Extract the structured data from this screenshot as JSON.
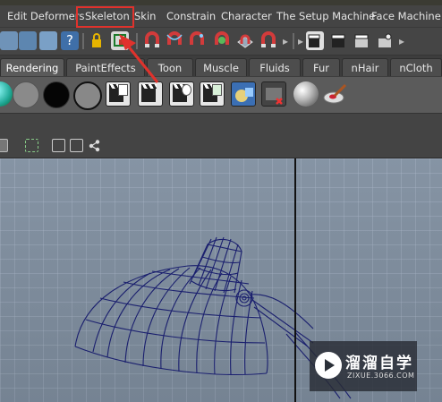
{
  "menubar": {
    "items": [
      "Edit Deformers",
      "Skeleton",
      "Skin",
      "Constrain",
      "Character",
      "The Setup Machine",
      "Face Machine"
    ],
    "highlighted": "Skeleton"
  },
  "shelf": {
    "tabs": [
      "Rendering",
      "PaintEffects",
      "Toon",
      "Muscle",
      "Fluids",
      "Fur",
      "nHair",
      "nCloth"
    ],
    "active_tab": "Rendering"
  },
  "watermark": {
    "title": "溜溜自学",
    "subtitle": "ZIXUE.3066.COM"
  },
  "colors": {
    "highlight_box": "#e0322c",
    "annotation_arrow": "#e0322c",
    "viewport_bg": "#7f8e9f",
    "wireframe": "#1a1f6e"
  }
}
